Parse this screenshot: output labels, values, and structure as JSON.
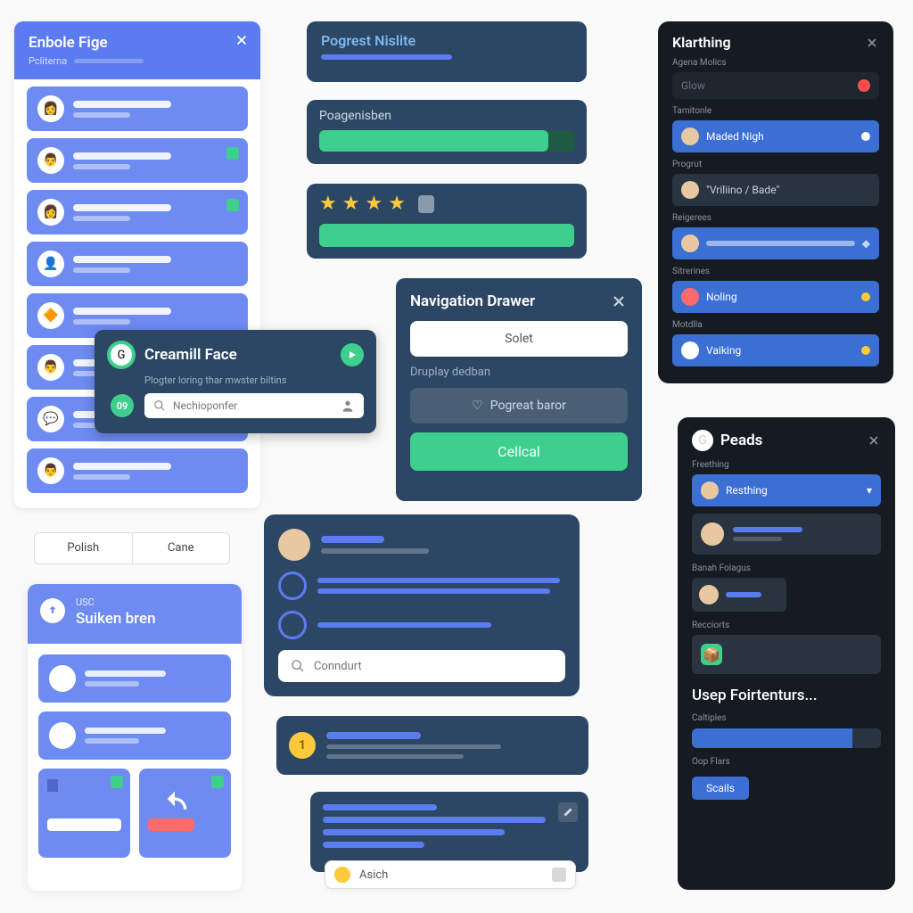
{
  "panelA": {
    "title": "Enbole Fige",
    "subtitle": "Pcliterna"
  },
  "panelB": {
    "tab1": "Polish",
    "tab2": "Cane"
  },
  "panelC": {
    "kicker": "USC",
    "title": "Suiken bren"
  },
  "panelD": {
    "title": "Pogrest Nislite"
  },
  "panelE": {
    "title": "Poagenisben"
  },
  "panelG": {
    "title": "Creamill Face",
    "subtitle": "Plogter loring thar mwster biltins",
    "placeholder": "Nechioponfer",
    "badge": "09"
  },
  "panelH": {
    "title": "Navigation Drawer",
    "btn1": "Solet",
    "label": "Druplay dedban",
    "btn2": "Pogreat baror",
    "btn3": "Cellcal"
  },
  "panelI": {
    "placeholder": "Conndurt"
  },
  "panelJ": {
    "num": "1"
  },
  "panelL": {
    "label": "Asich"
  },
  "panelM": {
    "title": "Klarthing",
    "sec1": "Agena Molics",
    "glow": "Glow",
    "sec2": "Tamitonle",
    "v2": "Maded Nigh",
    "sec3": "Progrut",
    "v3": "\"Vriliino / Bade\"",
    "sec4": "Reigerees",
    "sec5": "Sitrerines",
    "v5": "Noling",
    "sec6": "Motdlla",
    "v6": "Vaiking"
  },
  "panelN": {
    "title": "Peads",
    "sec1": "Freething",
    "v1": "Resthing",
    "sec2": "Banah Folagus",
    "sec3": "Recciorts",
    "bigt": "Usep Foirtenturs...",
    "sec4": "Caltiples",
    "sec5": "Oop Flars",
    "btn": "Scails"
  }
}
